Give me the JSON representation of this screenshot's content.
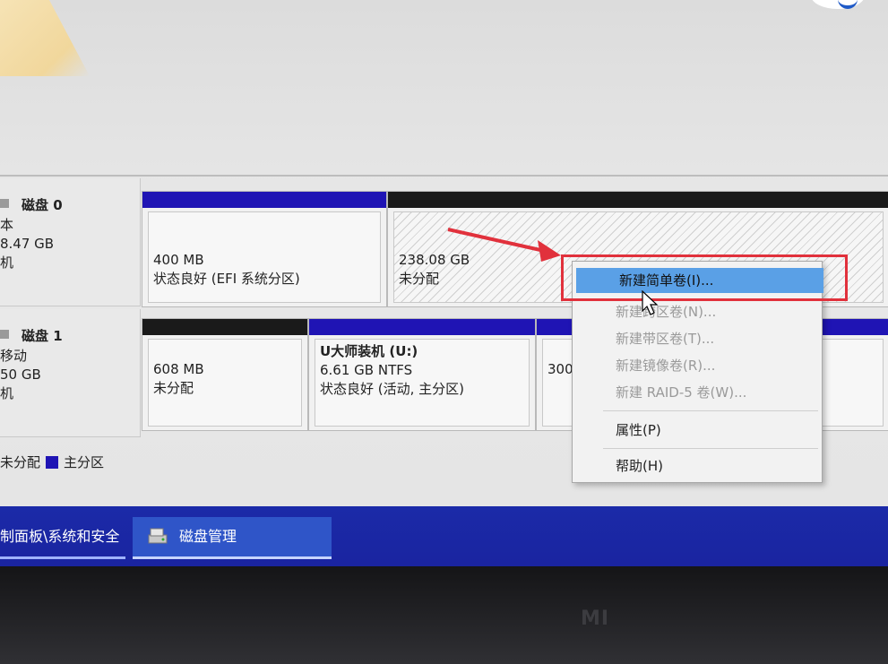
{
  "disks": [
    {
      "name": "磁盘 0",
      "type_line": "本",
      "size_line": "8.47 GB",
      "status_line": "机",
      "partitions": [
        {
          "size": "400 MB",
          "status": "状态良好 (EFI 系统分区)"
        },
        {
          "size": "238.08 GB",
          "status": "未分配"
        }
      ]
    },
    {
      "name": "磁盘 1",
      "type_line": "移动",
      "size_line": "50 GB",
      "status_line": "机",
      "partitions": [
        {
          "size": "608 MB",
          "status": "未分配"
        },
        {
          "title": "U大师装机  (U:)",
          "size": "6.61 GB NTFS",
          "status": "状态良好 (活动, 主分区)"
        },
        {
          "size": "300"
        }
      ]
    }
  ],
  "legend": {
    "unallocated": "未分配",
    "primary": "主分区",
    "colors": {
      "unallocated": "#1a1a1a",
      "primary": "#1f14b4"
    }
  },
  "context_menu": {
    "items": [
      {
        "label": "新建简单卷(I)...",
        "enabled": true,
        "highlighted": true
      },
      {
        "label": "新建跨区卷(N)...",
        "enabled": false
      },
      {
        "label": "新建带区卷(T)...",
        "enabled": false
      },
      {
        "label": "新建镜像卷(R)...",
        "enabled": false
      },
      {
        "label": "新建 RAID-5 卷(W)...",
        "enabled": false
      },
      {
        "label": "属性(P)",
        "enabled": true
      },
      {
        "label": "帮助(H)",
        "enabled": true
      }
    ]
  },
  "taskbar": {
    "task1": "制面板\\系统和安全",
    "task2": "磁盘管理"
  },
  "bezel": {
    "logo": "MI"
  },
  "colors": {
    "highlight": "#5aa0e6",
    "annotation_red": "#e1313c",
    "taskbar": "#1b2aa8"
  }
}
